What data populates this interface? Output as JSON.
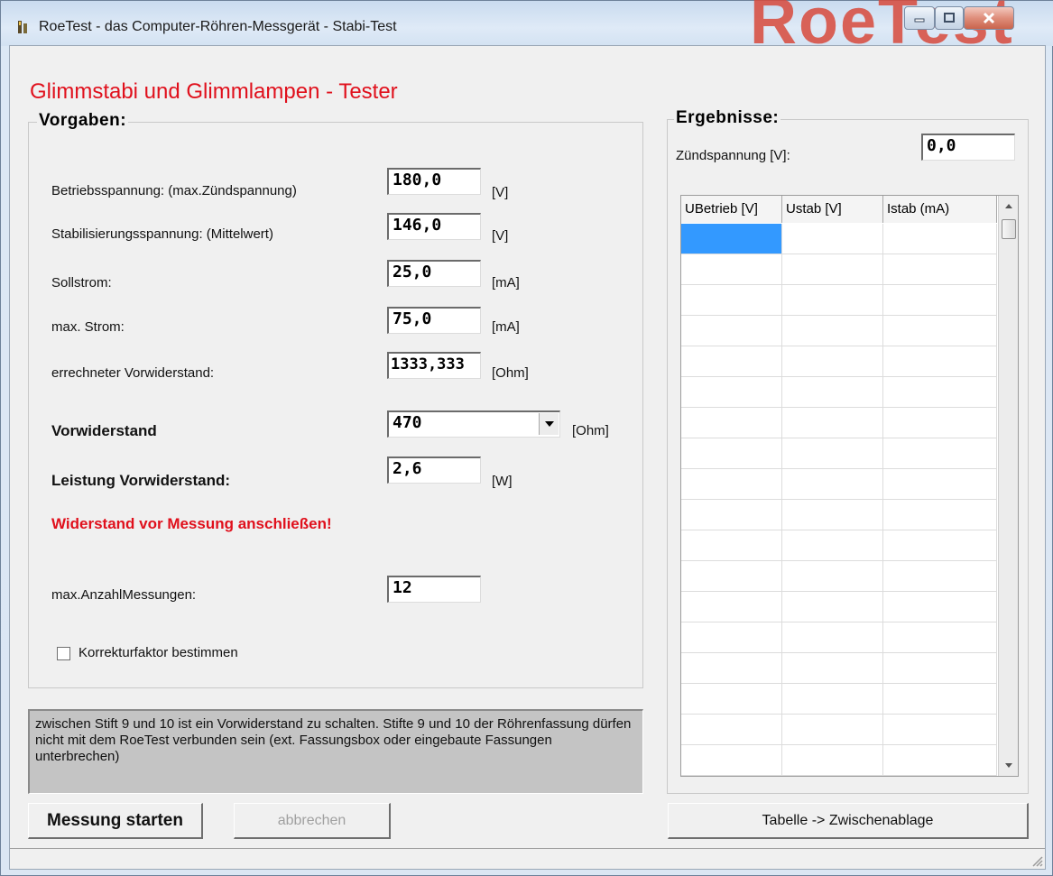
{
  "window": {
    "title": "RoeTest - das Computer-Röhren-Messgerät - Stabi-Test",
    "logo": "RoeTest"
  },
  "heading": "Glimmstabi und Glimmlampen - Tester",
  "vorgaben": {
    "group_label": "Vorgaben:",
    "fields": [
      {
        "label": "Betriebsspannung: (max.Zündspannung)",
        "value": "180,0",
        "unit": "[V]"
      },
      {
        "label": "Stabilisierungsspannung: (Mittelwert)",
        "value": "146,0",
        "unit": "[V]"
      },
      {
        "label": "Sollstrom:",
        "value": "25,0",
        "unit": "[mA]"
      },
      {
        "label": "max. Strom:",
        "value": "75,0",
        "unit": "[mA]"
      },
      {
        "label": "errechneter Vorwiderstand:",
        "value": "1333,333",
        "unit": "[Ohm]"
      }
    ],
    "vorwiderstand": {
      "label": "Vorwiderstand",
      "value": "470",
      "unit": "[Ohm]"
    },
    "leistung": {
      "label": "Leistung Vorwiderstand:",
      "value": "2,6",
      "unit": "[W]"
    },
    "warning": "Widerstand vor Messung  anschließen!",
    "max_messungen": {
      "label": "max.AnzahlMessungen:",
      "value": "12"
    },
    "korrektur": {
      "label": "Korrekturfaktor bestimmen",
      "checked": false
    }
  },
  "info_text": "zwischen Stift 9 und 10 ist ein Vorwiderstand zu schalten. Stifte 9 und 10 der Röhrenfassung dürfen nicht mit dem RoeTest verbunden sein (ext. Fassungsbox oder eingebaute Fassungen unterbrechen)",
  "buttons": {
    "start": "Messung starten",
    "abort": "abbrechen",
    "copy": "Tabelle -> Zwischenablage"
  },
  "ergebnisse": {
    "group_label": "Ergebnisse:",
    "zuend_label": "Zündspannung [V]:",
    "zuend_value": "0,0",
    "columns": [
      "UBetrieb [V]",
      "Ustab [V]",
      "Istab (mA)"
    ]
  },
  "colors": {
    "accent_red": "#e0101c",
    "selection_blue": "#3399ff"
  }
}
